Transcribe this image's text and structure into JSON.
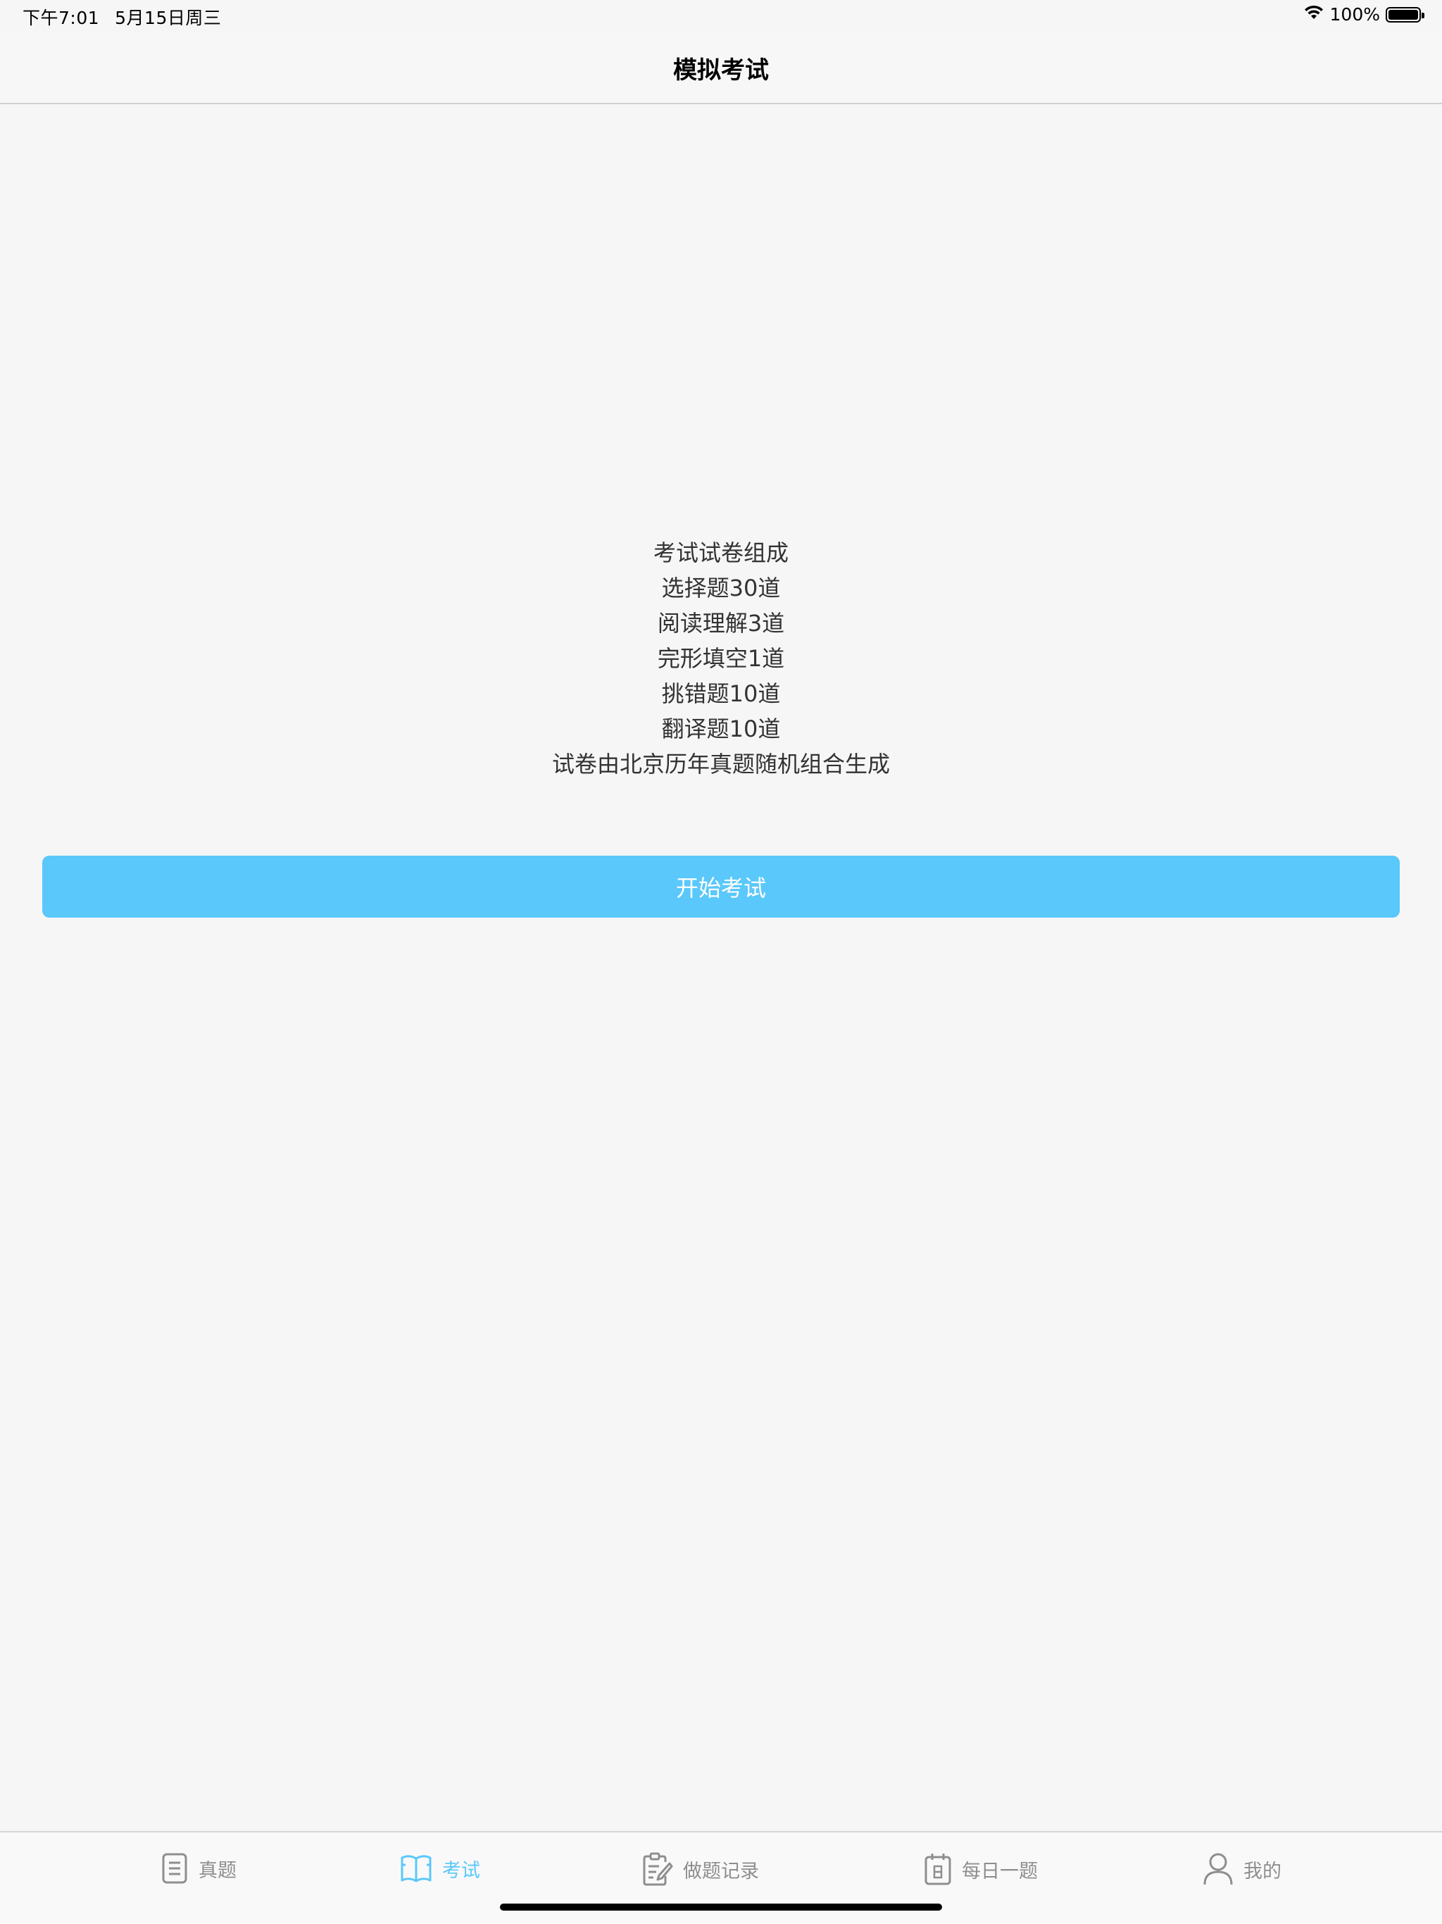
{
  "status_bar": {
    "time": "下午7:01",
    "date": "5月15日周三",
    "battery": "100%",
    "battery_level": 1.0
  },
  "nav": {
    "title": "模拟考试"
  },
  "info": {
    "lines": [
      "考试试卷组成",
      "选择题30道",
      "阅读理解3道",
      "完形填空1道",
      "挑错题10道",
      "翻译题10道",
      "试卷由北京历年真题随机组合生成"
    ]
  },
  "start_button": {
    "label": "开始考试",
    "color": "#5ac8fa"
  },
  "tabs": [
    {
      "label": "真题",
      "icon": "document-icon",
      "active": false
    },
    {
      "label": "考试",
      "icon": "book-icon",
      "active": true
    },
    {
      "label": "做题记录",
      "icon": "clipboard-edit-icon",
      "active": false
    },
    {
      "label": "每日一题",
      "icon": "calendar-icon",
      "active": false
    },
    {
      "label": "我的",
      "icon": "person-icon",
      "active": false
    }
  ],
  "colors": {
    "accent": "#5ac8fa",
    "inactive_tab": "#8e8e8e",
    "background": "#f6f6f6"
  }
}
